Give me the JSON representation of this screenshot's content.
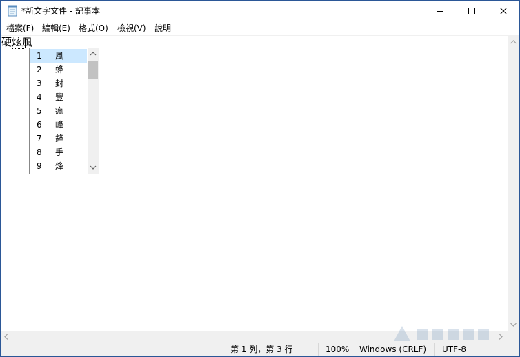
{
  "window": {
    "title": "*新文字文件 - 記事本",
    "border_color": "#2b5797"
  },
  "icons": {
    "app": "notepad-icon",
    "minimize": "minimize-icon",
    "maximize": "maximize-icon",
    "close": "close-icon"
  },
  "menu": {
    "items": [
      {
        "label": "檔案(F)"
      },
      {
        "label": "編輯(E)"
      },
      {
        "label": "格式(O)"
      },
      {
        "label": "檢視(V)"
      },
      {
        "label": "說明"
      }
    ]
  },
  "editor": {
    "committed_text": "硬",
    "composition_text": "炫",
    "pending_char": "風"
  },
  "ime_candidates": {
    "selected_index": 1,
    "selected_color": "#cce8ff",
    "items": [
      {
        "number": "1",
        "char": "風"
      },
      {
        "number": "2",
        "char": "蜂"
      },
      {
        "number": "3",
        "char": "封"
      },
      {
        "number": "4",
        "char": "豐"
      },
      {
        "number": "5",
        "char": "瘋"
      },
      {
        "number": "6",
        "char": "峰"
      },
      {
        "number": "7",
        "char": "鋒"
      },
      {
        "number": "8",
        "char": "手"
      },
      {
        "number": "9",
        "char": "烽"
      }
    ]
  },
  "statusbar": {
    "position": "第 1 列，第 3 行",
    "zoom": "100%",
    "line_ending": "Windows (CRLF)",
    "encoding": "UTF-8"
  }
}
